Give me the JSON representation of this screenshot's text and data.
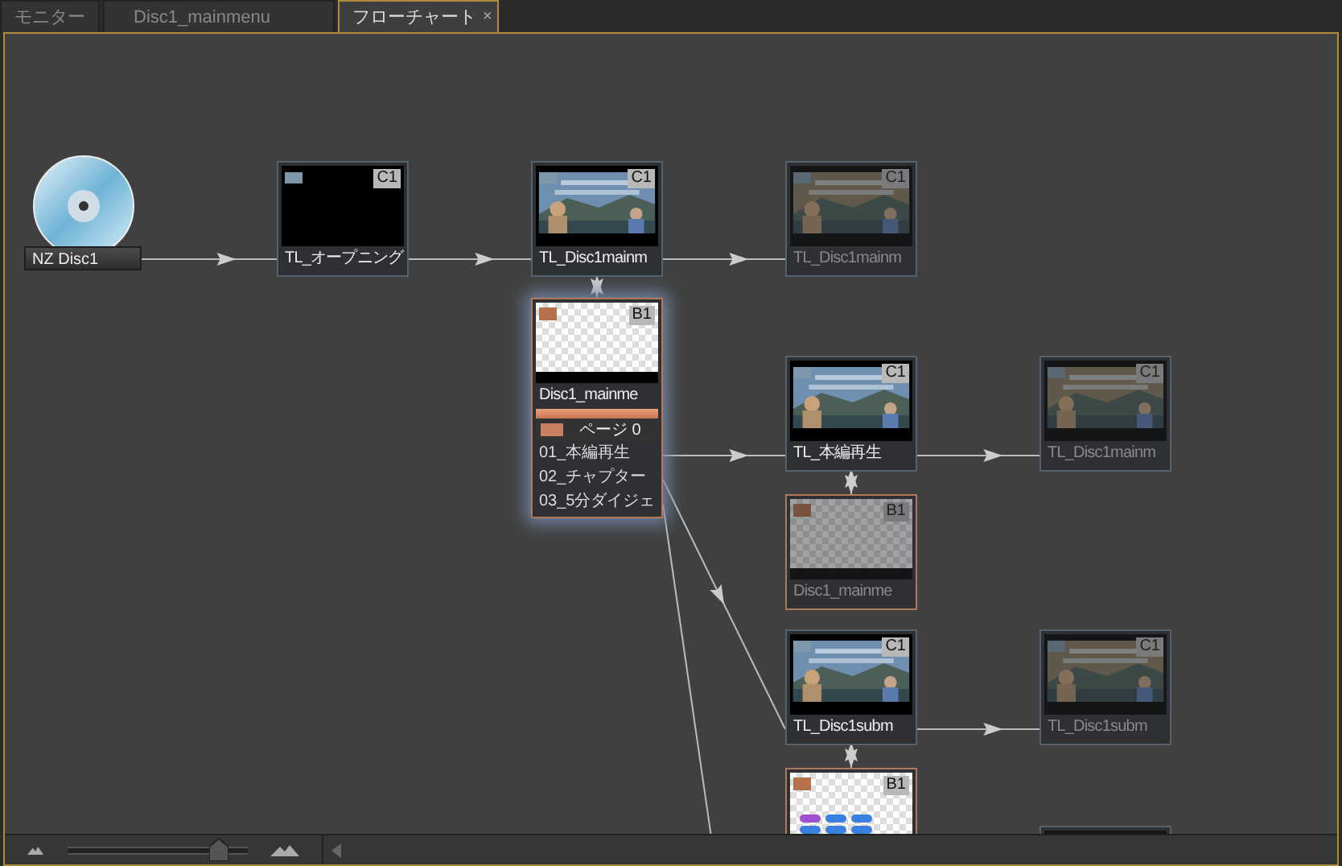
{
  "tabs": [
    {
      "label": "モニター",
      "selected": false
    },
    {
      "label": "Disc1_mainmenu",
      "selected": false
    },
    {
      "label": "フローチャート",
      "selected": true,
      "close": "×"
    }
  ],
  "flowchart": {
    "disc": {
      "label": "NZ Disc1"
    },
    "nodes": [
      {
        "kind": "timeline",
        "label": "TL_オープニング",
        "badge": "C1",
        "preview": {
          "kind": "blank"
        },
        "dimmed": false,
        "selected": false
      },
      {
        "kind": "timeline",
        "label": "TL_Disc1mainm",
        "badge": "C1",
        "dimmed": false,
        "selected": false
      },
      {
        "kind": "timeline",
        "label": "TL_Disc1mainm",
        "badge": "C1",
        "dimmed": true,
        "selected": false
      },
      {
        "kind": "menu",
        "label": "Disc1_mainme",
        "badge": "B1",
        "preview": {
          "kind": "transparent"
        },
        "dimmed": false,
        "selected": true,
        "page": "ページ 0",
        "buttons": [
          "01_本編再生",
          "02_チャプター",
          "03_5分ダイジェ"
        ]
      },
      {
        "kind": "timeline",
        "label": "TL_本編再生",
        "badge": "C1",
        "dimmed": false,
        "selected": false
      },
      {
        "kind": "timeline",
        "label": "TL_Disc1mainm",
        "badge": "C1",
        "dimmed": true,
        "selected": false
      },
      {
        "kind": "menu",
        "label": "Disc1_mainme",
        "badge": "B1",
        "preview": {
          "kind": "transparent"
        },
        "dimmed": true,
        "selected": false
      },
      {
        "kind": "timeline",
        "label": "TL_Disc1subm",
        "badge": "C1",
        "dimmed": false,
        "selected": false
      },
      {
        "kind": "timeline",
        "label": "TL_Disc1subm",
        "badge": "C1",
        "dimmed": true,
        "selected": false
      },
      {
        "kind": "menu",
        "badge": "B1",
        "preview": {
          "kind": "buttons"
        },
        "dimmed": false,
        "selected": false
      },
      {
        "dimmed": true,
        "selected": false
      }
    ]
  },
  "zoom_slider": {
    "level": 0.88
  }
}
